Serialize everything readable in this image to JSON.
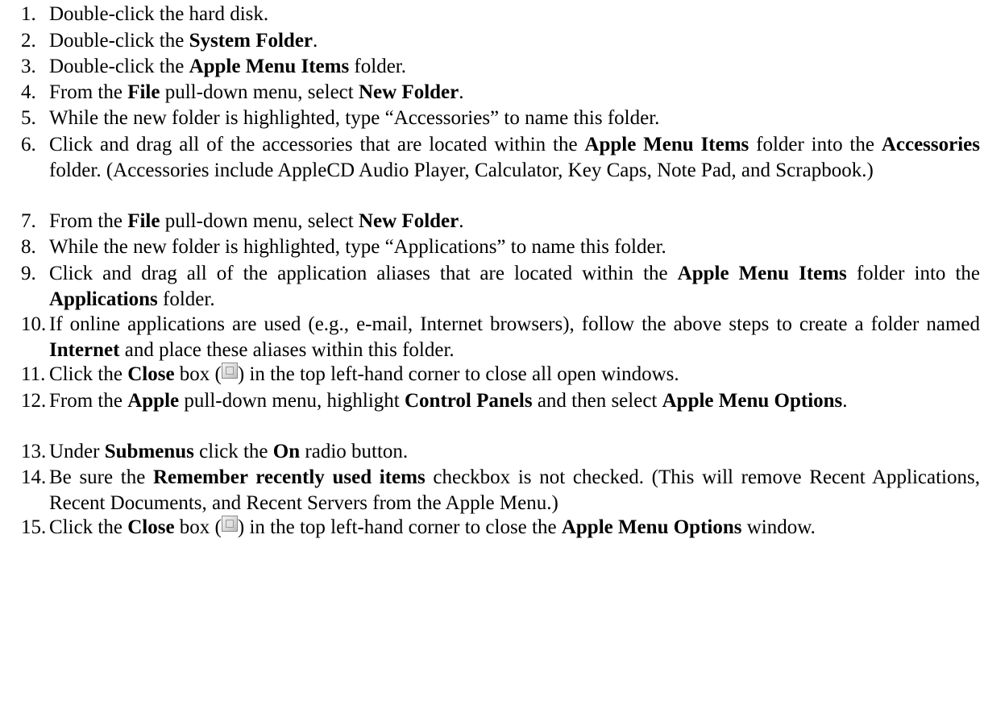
{
  "steps": [
    {
      "num": "1.",
      "parts": [
        {
          "t": "Double-click the hard disk."
        }
      ]
    },
    {
      "num": "2.",
      "parts": [
        {
          "t": "Double-click the "
        },
        {
          "t": "System Folder",
          "b": true
        },
        {
          "t": "."
        }
      ]
    },
    {
      "num": "3.",
      "parts": [
        {
          "t": "Double-click the "
        },
        {
          "t": "Apple Menu Items",
          "b": true
        },
        {
          "t": " folder."
        }
      ]
    },
    {
      "num": "4.",
      "parts": [
        {
          "t": "From the "
        },
        {
          "t": "File",
          "b": true
        },
        {
          "t": " pull-down menu, select "
        },
        {
          "t": "New Folder",
          "b": true
        },
        {
          "t": "."
        }
      ]
    },
    {
      "num": "5.",
      "parts": [
        {
          "t": "While the new folder is highlighted, type “Accessories” to name this folder."
        }
      ]
    },
    {
      "num": "6.",
      "parts": [
        {
          "t": "Click and drag all of the accessories that are located within the "
        },
        {
          "t": "Apple Menu Items",
          "b": true
        },
        {
          "t": " folder into the "
        },
        {
          "t": "Accessories",
          "b": true
        },
        {
          "t": " folder. (Accessories include AppleCD Audio Player, Calculator, Key Caps, Note Pad, and Scrapbook.)"
        }
      ]
    },
    {
      "num": "7.",
      "parts": [
        {
          "t": "From the "
        },
        {
          "t": "File",
          "b": true
        },
        {
          "t": " pull-down menu, select "
        },
        {
          "t": "New Folder",
          "b": true
        },
        {
          "t": "."
        }
      ]
    },
    {
      "num": "8.",
      "parts": [
        {
          "t": "While the new folder is highlighted, type “Applications” to name this folder."
        }
      ]
    },
    {
      "num": "9.",
      "parts": [
        {
          "t": "Click and drag all of the application aliases that are located within the "
        },
        {
          "t": "Apple Menu Items",
          "b": true
        },
        {
          "t": " folder into the "
        },
        {
          "t": "Applications",
          "b": true
        },
        {
          "t": " folder."
        }
      ]
    },
    {
      "num": "10.",
      "parts": [
        {
          "t": "If online applications are used (e.g., e-mail, Internet browsers), follow the above steps to create a folder named "
        },
        {
          "t": "Internet",
          "b": true
        },
        {
          "t": " and place these aliases within this folder."
        }
      ]
    },
    {
      "num": "11.",
      "parts": [
        {
          "t": "Click the "
        },
        {
          "t": "Close",
          "b": true
        },
        {
          "t": " box ("
        },
        {
          "icon": "close-box-icon"
        },
        {
          "t": ") in the top left-hand corner to close all open windows."
        }
      ]
    },
    {
      "num": "12.",
      "parts": [
        {
          "t": "From the "
        },
        {
          "t": "Apple",
          "b": true
        },
        {
          "t": " pull-down menu, highlight "
        },
        {
          "t": "Control Panels",
          "b": true
        },
        {
          "t": " and then select "
        },
        {
          "t": "Apple Menu Options",
          "b": true
        },
        {
          "t": "."
        }
      ]
    },
    {
      "num": "13.",
      "parts": [
        {
          "t": "Under "
        },
        {
          "t": "Submenus",
          "b": true
        },
        {
          "t": " click the "
        },
        {
          "t": "On",
          "b": true
        },
        {
          "t": " radio button."
        }
      ]
    },
    {
      "num": "14.",
      "parts": [
        {
          "t": "Be sure the "
        },
        {
          "t": "Remember recently used items",
          "b": true
        },
        {
          "t": " checkbox is not checked. (This will remove Recent Applications, Recent Documents, and Recent Servers from the Apple Menu.)"
        }
      ]
    },
    {
      "num": "15.",
      "parts": [
        {
          "t": "Click the "
        },
        {
          "t": "Close",
          "b": true
        },
        {
          "t": " box ("
        },
        {
          "icon": "close-box-icon"
        },
        {
          "t": ") in the top left-hand corner to close the "
        },
        {
          "t": "Apple Menu Options",
          "b": true
        },
        {
          "t": " window."
        }
      ]
    }
  ]
}
